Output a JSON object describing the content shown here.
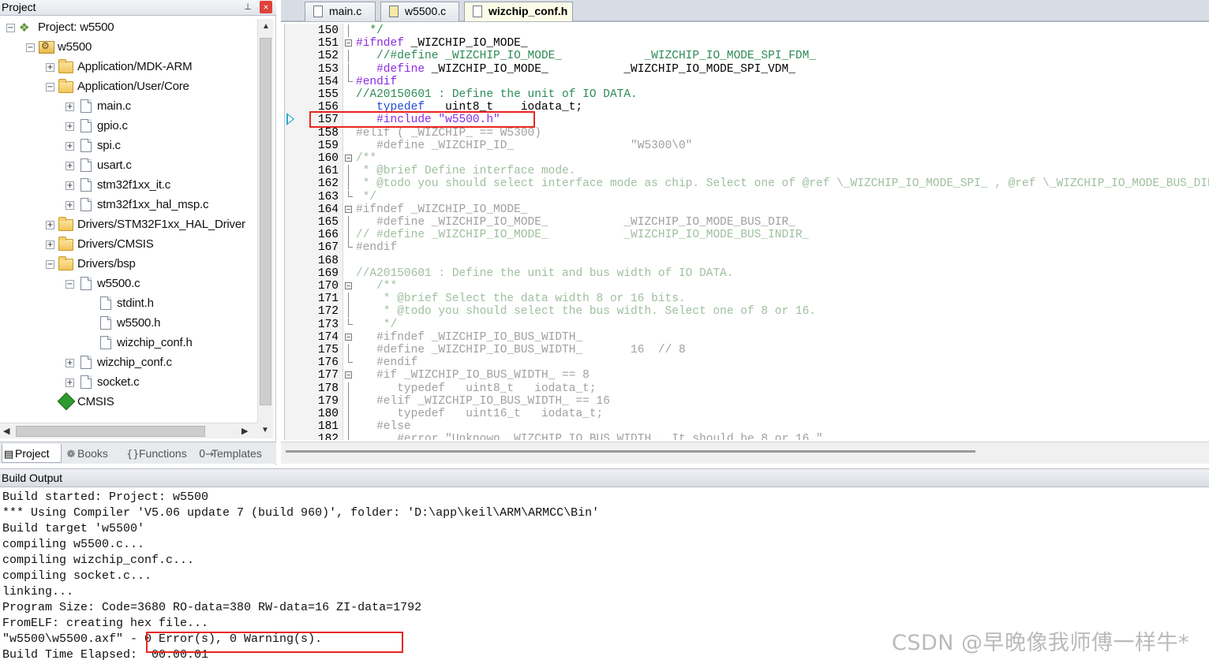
{
  "project_pane": {
    "title": "Project",
    "pin_glyph": "⊥",
    "close_glyph": "×",
    "tree": [
      {
        "label": "Project: w5500",
        "level": 0,
        "icon": "project-icon",
        "expander": "−"
      },
      {
        "label": "w5500",
        "level": 1,
        "icon": "target-icon",
        "expander": "−"
      },
      {
        "label": "Application/MDK-ARM",
        "level": 2,
        "icon": "folder-icon",
        "expander": "+"
      },
      {
        "label": "Application/User/Core",
        "level": 2,
        "icon": "folder-open-icon",
        "expander": "−"
      },
      {
        "label": "main.c",
        "level": 3,
        "icon": "file-icon",
        "expander": "+"
      },
      {
        "label": "gpio.c",
        "level": 3,
        "icon": "file-icon",
        "expander": "+"
      },
      {
        "label": "spi.c",
        "level": 3,
        "icon": "file-icon",
        "expander": "+"
      },
      {
        "label": "usart.c",
        "level": 3,
        "icon": "file-icon",
        "expander": "+"
      },
      {
        "label": "stm32f1xx_it.c",
        "level": 3,
        "icon": "file-icon",
        "expander": "+"
      },
      {
        "label": "stm32f1xx_hal_msp.c",
        "level": 3,
        "icon": "file-icon",
        "expander": "+"
      },
      {
        "label": "Drivers/STM32F1xx_HAL_Driver",
        "level": 2,
        "icon": "folder-icon",
        "expander": "+"
      },
      {
        "label": "Drivers/CMSIS",
        "level": 2,
        "icon": "folder-icon",
        "expander": "+"
      },
      {
        "label": "Drivers/bsp",
        "level": 2,
        "icon": "folder-open-icon",
        "expander": "−"
      },
      {
        "label": "w5500.c",
        "level": 3,
        "icon": "file-icon",
        "expander": "−"
      },
      {
        "label": "stdint.h",
        "level": 4,
        "icon": "file-icon",
        "expander": ""
      },
      {
        "label": "w5500.h",
        "level": 4,
        "icon": "file-icon",
        "expander": ""
      },
      {
        "label": "wizchip_conf.h",
        "level": 4,
        "icon": "file-icon",
        "expander": ""
      },
      {
        "label": "wizchip_conf.c",
        "level": 3,
        "icon": "file-icon",
        "expander": "+"
      },
      {
        "label": "socket.c",
        "level": 3,
        "icon": "file-icon",
        "expander": "+"
      },
      {
        "label": "CMSIS",
        "level": 2,
        "icon": "cmsis-icon",
        "expander": ""
      }
    ],
    "bottom_tabs": [
      {
        "label": "Project",
        "icon": "project-tab-icon",
        "glyph": "▤",
        "active": true
      },
      {
        "label": "Books",
        "icon": "books-icon",
        "glyph": "❁",
        "active": false
      },
      {
        "label": "Functions",
        "icon": "functions-icon",
        "glyph": "{}",
        "active": false
      },
      {
        "label": "Templates",
        "icon": "templates-icon",
        "glyph": "0→",
        "active": false
      }
    ]
  },
  "editor": {
    "tabs": [
      {
        "label": "main.c",
        "active": false,
        "yellow": false
      },
      {
        "label": "w5500.c",
        "active": false,
        "yellow": true
      },
      {
        "label": "wizchip_conf.h",
        "active": true,
        "yellow": false
      }
    ],
    "lines": [
      {
        "n": "150",
        "fold": "line",
        "segs": [
          [
            "c-green",
            "  */"
          ]
        ]
      },
      {
        "n": "151",
        "fold": "minus",
        "segs": [
          [
            "c-pp",
            "#ifndef"
          ],
          [
            "c-blk",
            " _WIZCHIP_IO_MODE_"
          ]
        ]
      },
      {
        "n": "152",
        "fold": "line",
        "segs": [
          [
            "c-cm",
            "   //#define _WIZCHIP_IO_MODE_            _WIZCHIP_IO_MODE_SPI_FDM_"
          ]
        ]
      },
      {
        "n": "153",
        "fold": "line",
        "segs": [
          [
            "c-pp",
            "   #define"
          ],
          [
            "c-blk",
            " _WIZCHIP_IO_MODE_           _WIZCHIP_IO_MODE_SPI_VDM_"
          ]
        ]
      },
      {
        "n": "154",
        "fold": "end",
        "segs": [
          [
            "c-pp",
            "#endif"
          ]
        ]
      },
      {
        "n": "155",
        "fold": "",
        "segs": [
          [
            "c-cm",
            "//A20150601 : Define the unit of IO DATA."
          ]
        ]
      },
      {
        "n": "156",
        "fold": "",
        "segs": [
          [
            "c-kw",
            "   typedef"
          ],
          [
            "c-blk",
            "   uint8_t    iodata_t;"
          ]
        ]
      },
      {
        "n": "157",
        "fold": "",
        "segs": [
          [
            "c-pp",
            "   #include"
          ],
          [
            "c-str",
            " \"w5500.h\""
          ]
        ]
      },
      {
        "n": "158",
        "fold": "",
        "segs": [
          [
            "c-dim",
            "#elif ( _WIZCHIP_ == W5300)"
          ]
        ]
      },
      {
        "n": "159",
        "fold": "",
        "segs": [
          [
            "c-dim",
            "   #define _WIZCHIP_ID_                 \"W5300\\0\""
          ]
        ]
      },
      {
        "n": "160",
        "fold": "minus",
        "segs": [
          [
            "c-dimcm",
            "/**"
          ]
        ]
      },
      {
        "n": "161",
        "fold": "line",
        "segs": [
          [
            "c-dimcm",
            " * @brief Define interface mode."
          ]
        ]
      },
      {
        "n": "162",
        "fold": "line",
        "segs": [
          [
            "c-dimcm",
            " * @todo you should select interface mode as chip. Select one of @ref \\_WIZCHIP_IO_MODE_SPI_ , @ref \\_WIZCHIP_IO_MODE_BUS_DIR_ or"
          ]
        ]
      },
      {
        "n": "163",
        "fold": "end",
        "segs": [
          [
            "c-dimcm",
            " */"
          ]
        ]
      },
      {
        "n": "164",
        "fold": "minus",
        "segs": [
          [
            "c-dim",
            "#ifndef _WIZCHIP_IO_MODE_"
          ]
        ]
      },
      {
        "n": "165",
        "fold": "line",
        "segs": [
          [
            "c-dim",
            "   #define _WIZCHIP_IO_MODE_           _WIZCHIP_IO_MODE_BUS_DIR_"
          ]
        ]
      },
      {
        "n": "166",
        "fold": "line",
        "segs": [
          [
            "c-dimcm",
            "// #define _WIZCHIP_IO_MODE_           _WIZCHIP_IO_MODE_BUS_INDIR_"
          ]
        ]
      },
      {
        "n": "167",
        "fold": "end",
        "segs": [
          [
            "c-dim",
            "#endif"
          ]
        ]
      },
      {
        "n": "168",
        "fold": "",
        "segs": []
      },
      {
        "n": "169",
        "fold": "",
        "segs": [
          [
            "c-dimcm",
            "//A20150601 : Define the unit and bus width of IO DATA."
          ]
        ]
      },
      {
        "n": "170",
        "fold": "minus",
        "segs": [
          [
            "c-dimcm",
            "   /**"
          ]
        ]
      },
      {
        "n": "171",
        "fold": "line",
        "segs": [
          [
            "c-dimcm",
            "    * @brief Select the data width 8 or 16 bits."
          ]
        ]
      },
      {
        "n": "172",
        "fold": "line",
        "segs": [
          [
            "c-dimcm",
            "    * @todo you should select the bus width. Select one of 8 or 16."
          ]
        ]
      },
      {
        "n": "173",
        "fold": "end",
        "segs": [
          [
            "c-dimcm",
            "    */"
          ]
        ]
      },
      {
        "n": "174",
        "fold": "minus",
        "segs": [
          [
            "c-dim",
            "   #ifndef _WIZCHIP_IO_BUS_WIDTH_"
          ]
        ]
      },
      {
        "n": "175",
        "fold": "line",
        "segs": [
          [
            "c-dim",
            "   #define _WIZCHIP_IO_BUS_WIDTH_       16  // 8"
          ]
        ]
      },
      {
        "n": "176",
        "fold": "end",
        "segs": [
          [
            "c-dim",
            "   #endif"
          ]
        ]
      },
      {
        "n": "177",
        "fold": "minus",
        "segs": [
          [
            "c-dim",
            "   #if _WIZCHIP_IO_BUS_WIDTH_ == 8"
          ]
        ]
      },
      {
        "n": "178",
        "fold": "line",
        "segs": [
          [
            "c-dim",
            "      typedef   uint8_t   iodata_t;"
          ]
        ]
      },
      {
        "n": "179",
        "fold": "line",
        "segs": [
          [
            "c-dim",
            "   #elif _WIZCHIP_IO_BUS_WIDTH_ == 16"
          ]
        ]
      },
      {
        "n": "180",
        "fold": "line",
        "segs": [
          [
            "c-dim",
            "      typedef   uint16_t   iodata_t;"
          ]
        ]
      },
      {
        "n": "181",
        "fold": "line",
        "segs": [
          [
            "c-dim",
            "   #else"
          ]
        ]
      },
      {
        "n": "182",
        "fold": "line",
        "segs": [
          [
            "c-dim",
            "      #error \"Unknown _WIZCHIP_IO_BUS_WIDTH_. It should be 8 or 16.\""
          ]
        ]
      }
    ]
  },
  "build_output": {
    "title": "Build Output",
    "lines": [
      "Build started: Project: w5500",
      "*** Using Compiler 'V5.06 update 7 (build 960)', folder: 'D:\\app\\keil\\ARM\\ARMCC\\Bin'",
      "Build target 'w5500'",
      "compiling w5500.c...",
      "compiling wizchip_conf.c...",
      "compiling socket.c...",
      "linking...",
      "Program Size: Code=3680 RO-data=380 RW-data=16 ZI-data=1792",
      "FromELF: creating hex file...",
      "\"w5500\\w5500.axf\" - 0 Error(s), 0 Warning(s).",
      "Build Time Elapsed:  00:00:01"
    ]
  },
  "watermark": "CSDN @早晚像我师傅一样牛*",
  "colors": {
    "highlight": "#e8261f",
    "preprocessor": "#8a2be2",
    "keyword": "#1f4fd0",
    "comment": "#2e8b57",
    "inactive_code": "#a0a0a0"
  }
}
